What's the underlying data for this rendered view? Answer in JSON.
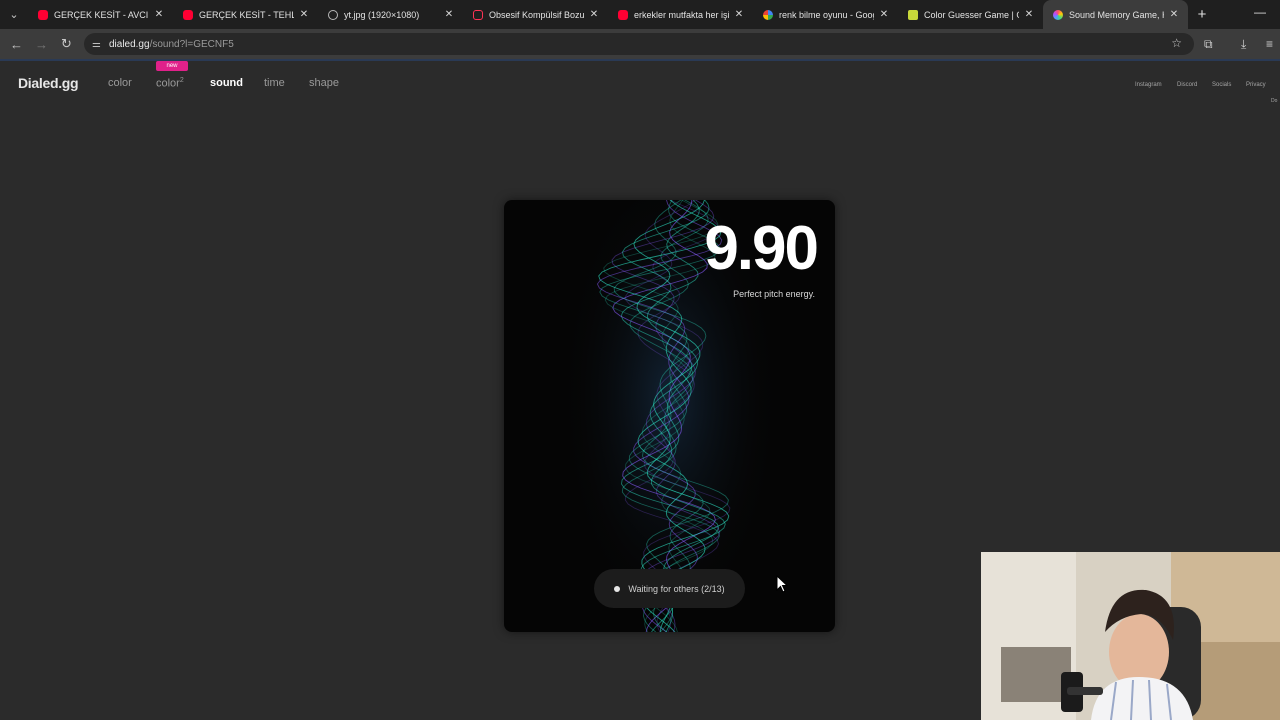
{
  "browser": {
    "tabs": [
      {
        "title": "GERÇEK KESİT - AVCI - Yo",
        "favicon": "youtube-icon",
        "active": false
      },
      {
        "title": "GERÇEK KESİT - TEHLİKELİ",
        "favicon": "youtube-icon",
        "active": false
      },
      {
        "title": "yt.jpg (1920×1080)",
        "favicon": "globe-icon",
        "active": false
      },
      {
        "title": "Obsesif Kompülsif Bozukl",
        "favicon": "youtube-outline-icon",
        "active": false
      },
      {
        "title": "erkekler mutfakta her işi y",
        "favicon": "youtube-icon",
        "active": false
      },
      {
        "title": "renk bilme oyunu - Goog",
        "favicon": "google-icon",
        "active": false
      },
      {
        "title": "Color Guesser Game | Gu",
        "favicon": "sheet-icon",
        "active": false
      },
      {
        "title": "Sound Memory Game, Ho",
        "favicon": "dialed-icon",
        "active": true
      }
    ],
    "url_host": "dialed.gg",
    "url_path": "/sound?l=GECNF5"
  },
  "site": {
    "logo": "Dialed.gg",
    "nav": {
      "color": "color",
      "color2": "color",
      "color2_sup": "2",
      "sound": "sound",
      "time": "time",
      "shape": "shape",
      "new_badge": "new"
    },
    "links": {
      "instagram": "Instagram",
      "discord": "Discord",
      "socials": "Socials",
      "privacy": "Privacy",
      "cut": "Do"
    }
  },
  "game": {
    "score": "9.90",
    "subtitle": "Perfect pitch energy.",
    "status": "Waiting for others (2/13)"
  },
  "colors": {
    "background": "#2b2b2b",
    "card": "#050505",
    "badge": "#e0218a",
    "wave_teal": "#2ee6c8",
    "wave_purple": "#8a5cff"
  }
}
